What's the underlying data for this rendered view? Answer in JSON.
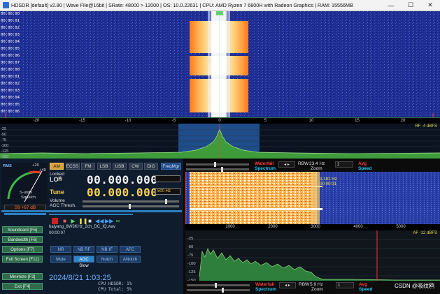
{
  "titlebar": {
    "title": "HDSDR  [default]  v2.80  |  Wave File@16bit  |  SRate: 48000 > 12000  |  OS: 10.0.22631  |  CPU: AMD Ryzen 7 6800H with Radeon Graphics  |  RAM: 15556MB",
    "min": "—",
    "max": "☐",
    "close": "✕"
  },
  "waterfall_top": {
    "time_labels": [
      "00:00:00",
      "00:00:01",
      "00:00:02",
      "00:00:03",
      "00:00:04",
      "00:00:05",
      "00:00:06",
      "00:00:07",
      "00:00:00",
      "00:00:01",
      "00:00:02",
      "00:00:03",
      "00:00:04",
      "00:00:05",
      "00:00:06"
    ],
    "freq_axis": [
      "-20",
      "-15",
      "-10",
      "-5",
      "0",
      "5",
      "10",
      "15",
      "20"
    ],
    "spectrum_y": [
      "-25",
      "-50",
      "-75",
      "-100",
      "-125",
      "-150"
    ],
    "rf_level": "RF -4 dBFS"
  },
  "meter": {
    "rms": "RMS",
    "scale": [
      "1",
      "3",
      "5",
      "7",
      "9",
      "+20",
      "+40",
      "+60"
    ],
    "smeter_label": "S-units",
    "squelch_label": "Squelch",
    "db_readout": "S9 +67 dB"
  },
  "modes": [
    "AM",
    "ECSS",
    "FM",
    "LSB",
    "USB",
    "CW",
    "DIG"
  ],
  "freqmgr": "FreqMgr",
  "lo": {
    "locked": "Locked",
    "label": "LO",
    "badge": "A",
    "freq": "00.000.000"
  },
  "tune": {
    "label": "Tune",
    "freq": "00.000.000",
    "step": "500 Hz"
  },
  "volume_label": "Volume",
  "agc_label": "AGC Thresh.",
  "side_buttons": [
    "Soundcard [F5]",
    "Bandwidth [F6]",
    "Options [F7]",
    "Full Screen [F11]"
  ],
  "file": {
    "name": "baiyang_8W3KHz_2ch_DC_IQ.wav",
    "time": "00:00:07"
  },
  "dsp_row1": [
    "NR",
    "NB RF",
    "NB IF",
    "AFC"
  ],
  "dsp_row2": [
    "Mute",
    "AGC Slow",
    "Notch",
    "ANotch"
  ],
  "bottom_buttons": [
    "Minimize [F3]",
    "Exit [F4]"
  ],
  "clock": "2024/8/21 1:03:25",
  "cpu_hdsdr": "CPU HDSDR: 1%",
  "cpu_total": "CPU Total: 5%",
  "rf_controls": {
    "waterfall": "Waterfall",
    "spectrum": "Spectrum",
    "rbw": "RBW",
    "rbw_val": "23.4 Hz",
    "zoom": "Zoom",
    "avg_num": "2",
    "avg": "Avg",
    "speed": "Speed"
  },
  "af_controls": {
    "waterfall": "Waterfall",
    "spectrum": "Spectrum",
    "rbw": "RBW",
    "rbw_val": "5.9 Hz",
    "zoom": "Zoom",
    "avg_num": "1",
    "avg": "Avg",
    "speed": "Speed"
  },
  "af_waterfall": {
    "marker_freq": "3,181 Hz",
    "marker_time": "00:00:01"
  },
  "af_axis": [
    "1000",
    "2000",
    "3000",
    "4000",
    "5000"
  ],
  "af_spectrum_y": [
    "-25",
    "-50",
    "-75",
    "-100",
    "-125",
    "-150"
  ],
  "af_level": "AF -12 dBFS",
  "watermark": "CSDN @吸纹鸥"
}
